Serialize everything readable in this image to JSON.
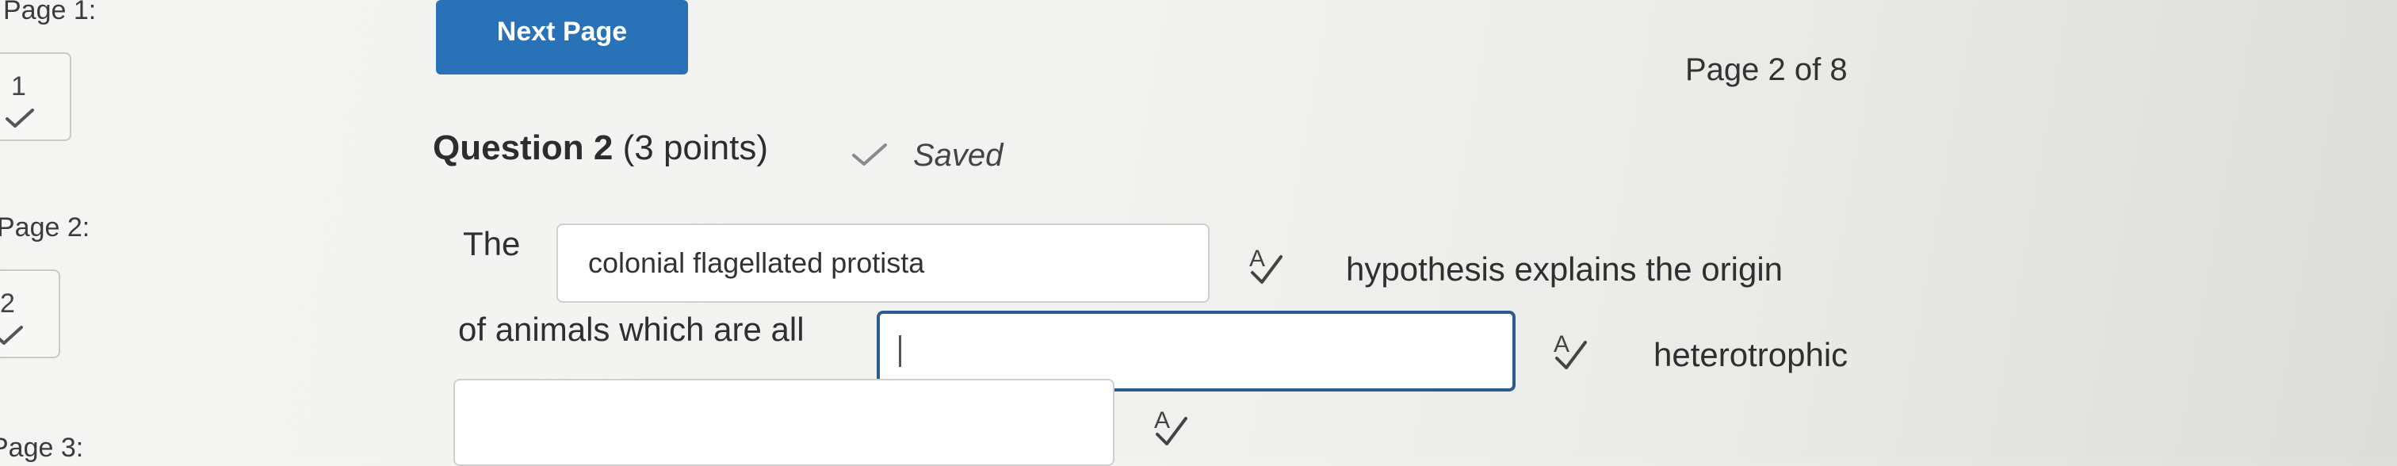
{
  "sidebar": {
    "pages": [
      {
        "label": "Page 1:",
        "number": "1",
        "answered": true
      },
      {
        "label": "Page 2:",
        "number": "2",
        "answered": true
      },
      {
        "label": "Page 3:"
      }
    ]
  },
  "nav": {
    "next_label": "Next Page",
    "page_indicator": "Page 2 of 8"
  },
  "question": {
    "title": "Question 2",
    "points": "(3 points)",
    "status": "Saved",
    "text_1": "The",
    "blank_1_value": "colonial flagellated protista",
    "text_2": "hypothesis explains the origin",
    "text_3": "of animals which are all",
    "blank_2_value": "",
    "text_4": "heterotrophic",
    "blank_3_value": ""
  },
  "icons": {
    "check": "check-icon",
    "spellcheck": "spellcheck-icon"
  },
  "colors": {
    "accent": "#2a72b8",
    "focus_border": "#2c5c8c",
    "check_mark": "#888888"
  }
}
